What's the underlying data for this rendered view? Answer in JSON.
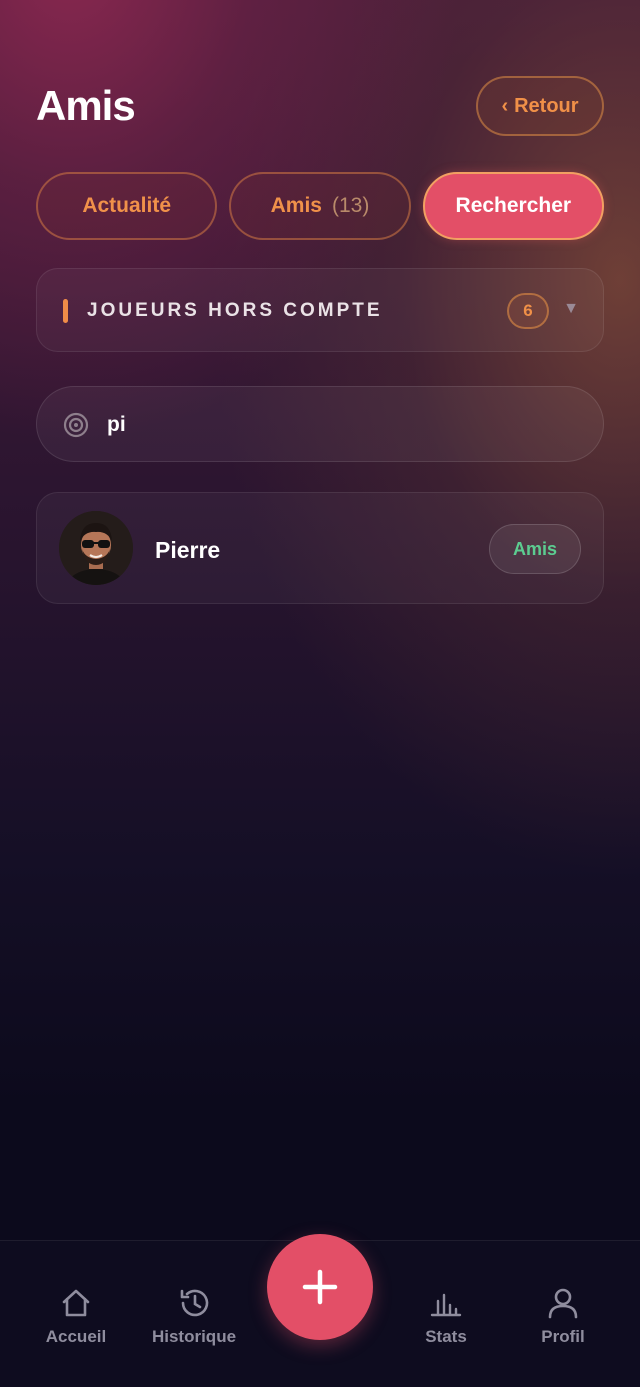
{
  "header": {
    "title": "Amis",
    "back_label": "Retour",
    "back_icon": "chevron-left-icon"
  },
  "tabs": [
    {
      "label": "Actualité",
      "count": "",
      "active": false
    },
    {
      "label": "Amis",
      "count": "(13)",
      "active": false
    },
    {
      "label": "Rechercher",
      "count": "",
      "active": true
    }
  ],
  "section": {
    "title": "JOUEURS HORS COMPTE",
    "count": "6",
    "icon": "chevron-down-icon"
  },
  "search": {
    "value": "pi",
    "icon": "target-icon"
  },
  "results": [
    {
      "name": "Pierre",
      "status": "Amis",
      "avatar": "avatar-photo"
    }
  ],
  "bottom_nav": {
    "items": [
      {
        "label": "Accueil",
        "icon": "home-icon"
      },
      {
        "label": "Historique",
        "icon": "history-icon"
      },
      {
        "label": "Stats",
        "icon": "bar-chart-icon"
      },
      {
        "label": "Profil",
        "icon": "user-icon"
      }
    ],
    "fab_icon": "plus-icon"
  },
  "colors": {
    "accent": "#e34f67",
    "orange": "#f09048",
    "green": "#5ccc90",
    "background": "#0c0a1c"
  }
}
